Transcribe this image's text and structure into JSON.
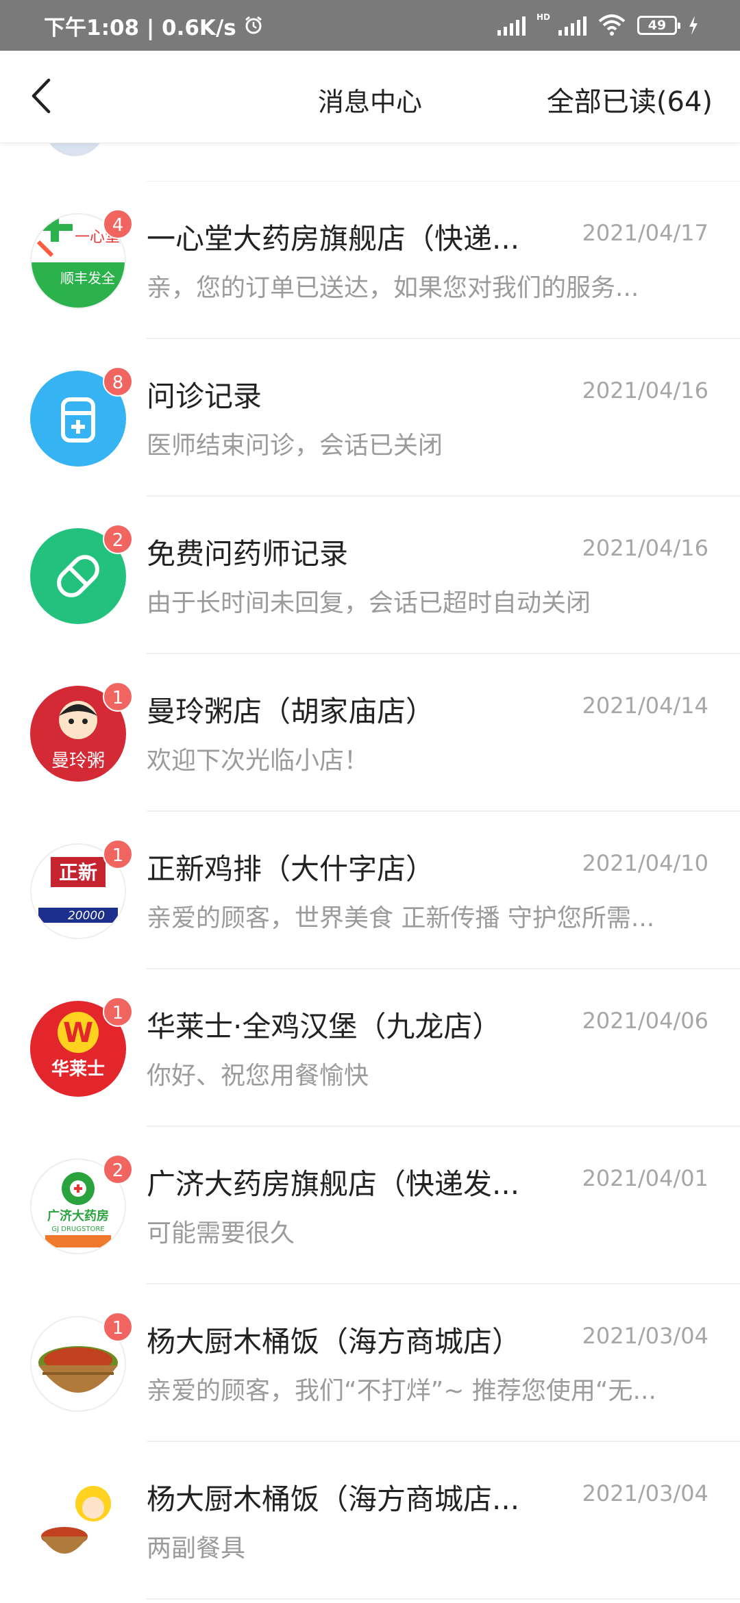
{
  "status_bar": {
    "time_speed": "下午1:08 | 0.6K/s",
    "hd_label": "HD",
    "battery": "49"
  },
  "header": {
    "title": "消息中心",
    "read_all": "全部已读(64)",
    "back_icon": "chevron-left-icon"
  },
  "messages": [
    {
      "title": "一心堂大药房旗舰店（快递...",
      "date": "2021/04/17",
      "preview": "亲，您的订单已送达，如果您对我们的服务...",
      "badge": "4",
      "avatar_text": "一心堂",
      "avatar_text2": "顺丰发全",
      "avatar_color": "#2bb24c"
    },
    {
      "title": "问诊记录",
      "date": "2021/04/16",
      "preview": "医师结束问诊，会话已关闭",
      "badge": "8",
      "avatar_icon": "doctor-icon",
      "avatar_color": "#35b3f2"
    },
    {
      "title": "免费问药师记录",
      "date": "2021/04/16",
      "preview": "由于长时间未回复，会话已超时自动关闭",
      "badge": "2",
      "avatar_icon": "pill-icon",
      "avatar_color": "#22c27e"
    },
    {
      "title": "曼玲粥店（胡家庙店）",
      "date": "2021/04/14",
      "preview": "欢迎下次光临小店！",
      "badge": "1",
      "avatar_text": "曼玲粥",
      "avatar_color": "#d32a35"
    },
    {
      "title": "正新鸡排（大什字店）",
      "date": "2021/04/10",
      "preview": "亲爱的顾客，世界美食 正新传播 守护您所需...",
      "badge": "1",
      "avatar_text": "正新",
      "avatar_text2": "20000",
      "avatar_color": "#c4232f"
    },
    {
      "title": "华莱士·全鸡汉堡（九龙店）",
      "date": "2021/04/06",
      "preview": "你好、祝您用餐愉快",
      "badge": "1",
      "avatar_text": "W",
      "avatar_text2": "华莱士",
      "avatar_color": "#e3262b"
    },
    {
      "title": "广济大药房旗舰店（快递发...",
      "date": "2021/04/01",
      "preview": "可能需要很久",
      "badge": "2",
      "avatar_text": "广济大药房",
      "avatar_text2": "GJ DRUGSTORE",
      "avatar_color": "#2aa33f"
    },
    {
      "title": "杨大厨木桶饭（海方商城店）",
      "date": "2021/03/04",
      "preview": "亲爱的顾客，我们“不打烊”~ 推荐您使用“无...",
      "badge": "1",
      "avatar_color": "#b55a2a"
    },
    {
      "title": "杨大厨木桶饭（海方商城店...",
      "date": "2021/03/04",
      "preview": "两副餐具",
      "badge": "",
      "avatar_color": "#b55a2a"
    }
  ]
}
